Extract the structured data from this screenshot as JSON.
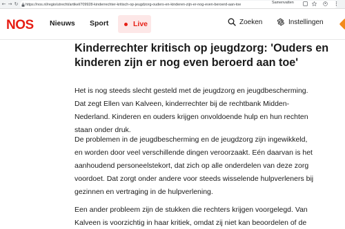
{
  "browser": {
    "url": "https://nos.nl/regio/utrecht/artikel/709928-kinderrechter-kritisch-op-jeugdzorg-ouders-en-kinderen-zijn-er-nog-even-beroerd-aan-toe",
    "summarize_label": "Samenvatten",
    "back_glyph": "←",
    "forward_glyph": "→",
    "reload_glyph": "↻"
  },
  "header": {
    "logo_text": "NOS",
    "nav": {
      "news_label": "Nieuws",
      "sport_label": "Sport",
      "live_label": "Live"
    },
    "search_label": "Zoeken",
    "settings_label": "Instellingen"
  },
  "colors": {
    "brand_red": "#e61e14",
    "live_background": "#fde7e7",
    "corner_accent": "#f28a1a"
  },
  "icons": [
    "search-icon",
    "gear-icon",
    "lock-icon",
    "back-icon",
    "forward-icon",
    "reload-icon"
  ],
  "article": {
    "headline": "Kinderrechter kritisch op jeugdzorg: 'Ouders en kinderen zijn er nog even beroerd aan toe'",
    "paragraphs": [
      "Het is nog steeds slecht gesteld met de jeugdzorg en jeugdbescherming. Dat zegt Ellen van Kalveen, kinderrechter bij de rechtbank Midden-Nederland. Kinderen en ouders krijgen onvoldoende hulp en hun rechten staan onder druk.",
      "De problemen in de jeugdbescherming en de jeugdzorg zijn ingewikkeld, en worden door veel verschillende dingen veroorzaakt. Eén daarvan is het aanhoudend personeelstekort, dat zich op alle onderdelen van deze zorg voordoet. Dat zorgt onder andere voor steeds wisselende hulpverleners bij gezinnen en vertraging in de hulpverlening.",
      "Een ander probleem zijn de stukken die rechters krijgen voorgelegd. Van Kalveen is voorzichtig in haar kritiek, omdat zij niet kan beoordelen of de"
    ]
  }
}
